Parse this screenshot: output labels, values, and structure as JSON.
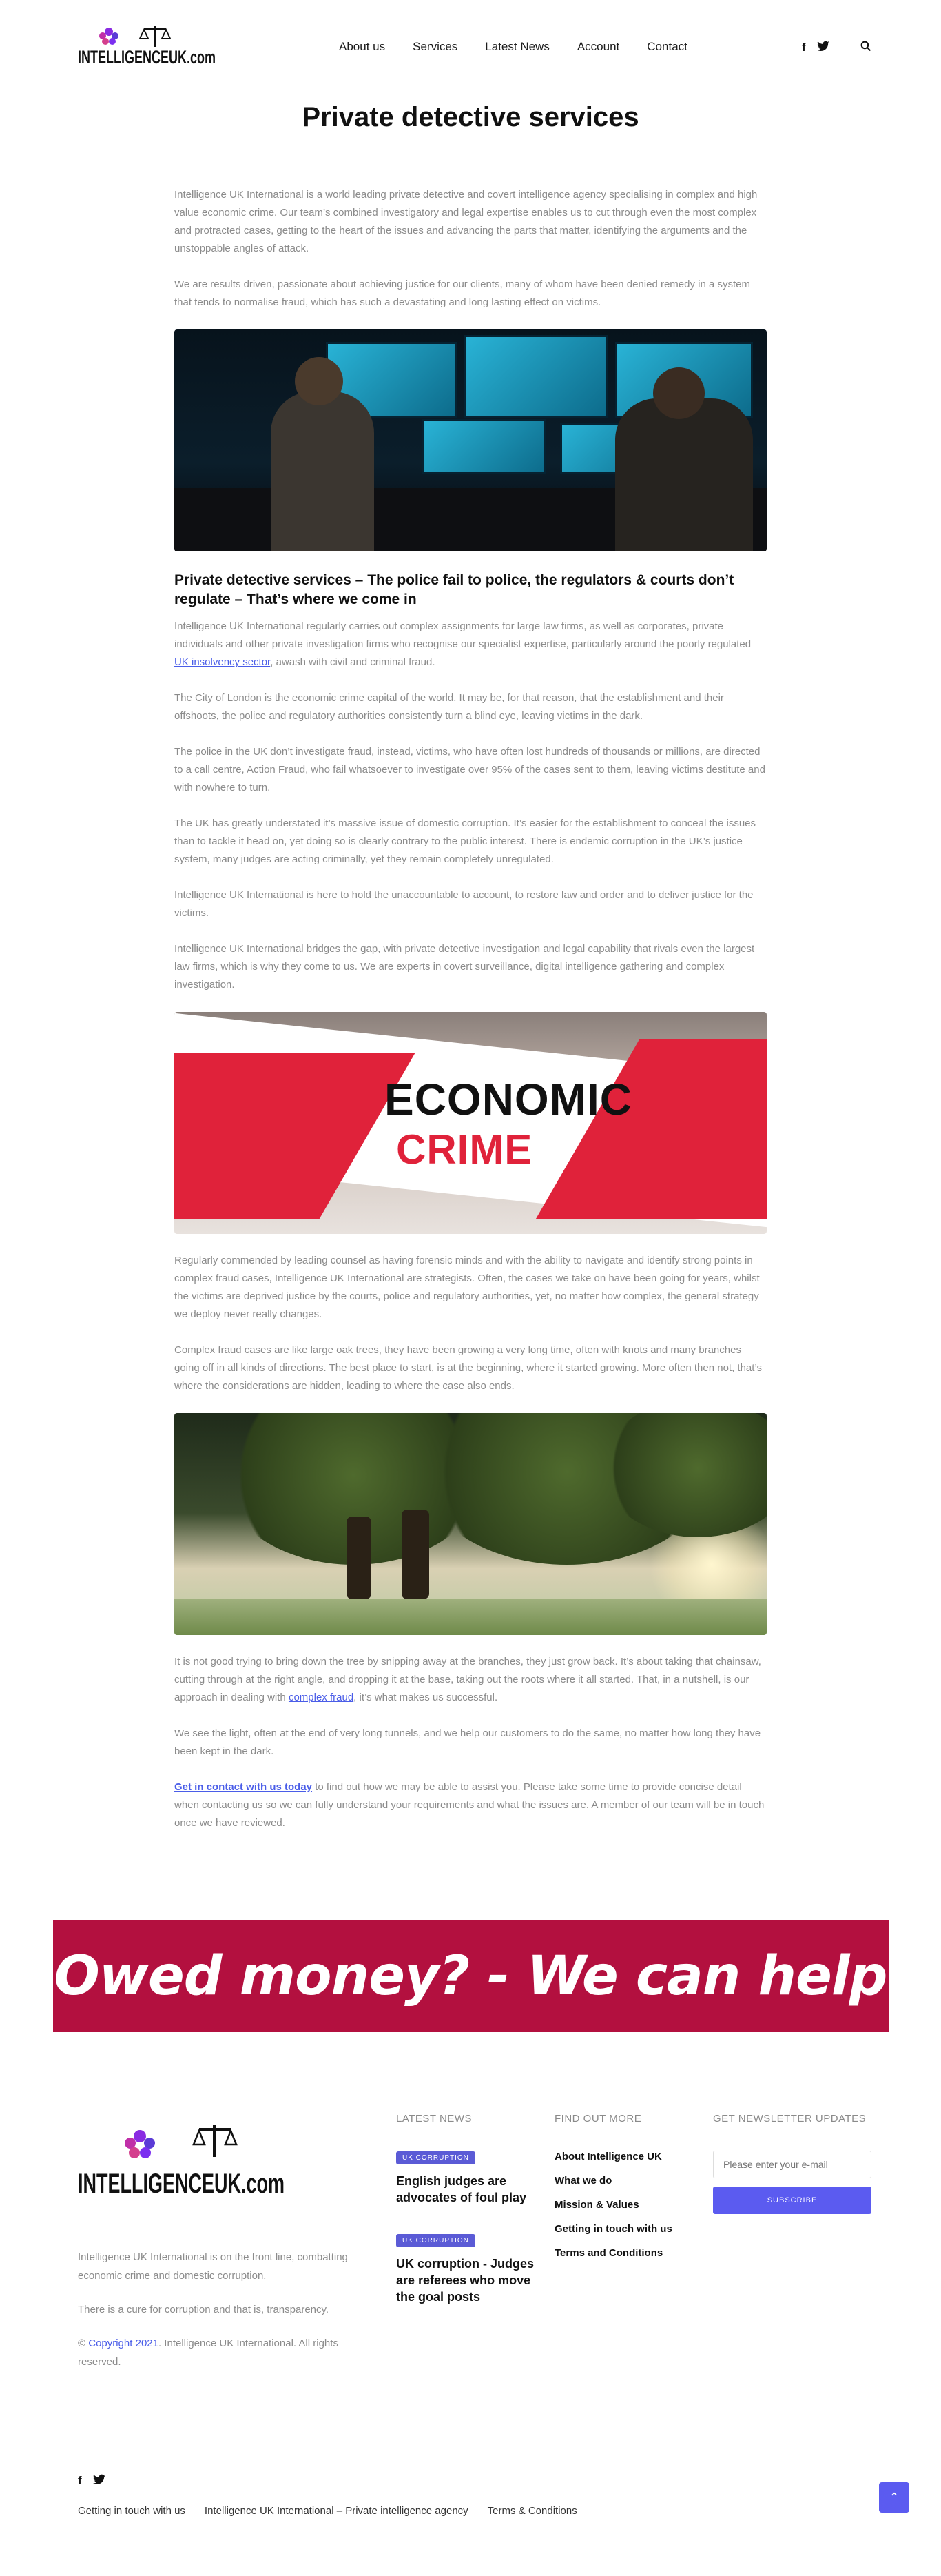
{
  "header": {
    "logo_text": "INTELLIGENCEUK.com",
    "nav": [
      "About us",
      "Services",
      "Latest News",
      "Account",
      "Contact"
    ],
    "social": [
      "facebook-icon",
      "twitter-icon"
    ],
    "search_icon": "search-icon"
  },
  "page_title": "Private detective services",
  "content": {
    "p1": "Intelligence UK International is a world leading private detective and covert intelligence agency specialising in complex and high value economic crime. Our team’s combined investigatory and legal expertise enables us to cut through even the most complex and protracted cases, getting to the heart of the issues and advancing the parts that matter, identifying the arguments and the unstoppable angles of attack.",
    "p2": "We are results driven, passionate about achieving justice for our clients, many of whom have been denied remedy in a system that tends to normalise fraud, which has such a devastating and long lasting effect on victims.",
    "h2": "Private detective services – The police fail to police, the regulators & courts don’t regulate – That’s where we come in",
    "p3_a": "Intelligence UK International regularly carries out complex assignments for large law firms, as well as corporates, private individuals and other private investigation firms who recognise our specialist expertise, particularly around the poorly regulated ",
    "p3_link": "UK insolvency sector",
    "p3_b": ", awash with civil and criminal fraud.",
    "p4": "The City of London is the economic crime capital of the world. It may be, for that reason, that the establishment and their offshoots, the police and regulatory authorities consistently turn a blind eye, leaving victims in the dark.",
    "p5": "The police in the UK don’t investigate fraud, instead, victims, who have often lost hundreds of thousands or millions, are directed to a call centre, Action Fraud, who fail whatsoever to investigate over 95% of the cases sent to them, leaving victims destitute and with nowhere to turn.",
    "p6": "The UK has greatly understated it’s massive issue of domestic corruption. It’s easier for the establishment to conceal the issues than to tackle it head on, yet doing so is clearly contrary to the public interest. There is endemic corruption in the UK’s justice system, many judges are acting criminally, yet they remain completely unregulated.",
    "p7": "Intelligence UK International is here to hold the unaccountable to account, to restore law and order and to deliver justice for the victims.",
    "p8": "Intelligence UK International bridges the gap, with private detective investigation and legal capability that rivals even the largest law firms, which is why they come to us. We are experts in covert surveillance, digital intelligence gathering and complex investigation.",
    "crime_line1": "ECONOMIC",
    "crime_line2": "CRIME",
    "p9": "Regularly commended by leading counsel as having forensic minds and with the ability to navigate and identify strong points in complex fraud cases, Intelligence UK International are strategists. Often, the cases we take on have been going for years, whilst the victims are deprived justice by the courts, police and regulatory authorities, yet, no matter how complex, the general strategy we deploy never really changes.",
    "p10": "Complex fraud cases are like large oak trees, they have been growing a very long time, often with knots and many branches going off in all kinds of directions. The best place to start, is at the beginning, where it started growing. More often then not, that’s where the considerations are hidden, leading to where the case also ends.",
    "p11_a": "It is not good trying to bring down the tree by snipping away at the branches, they just grow back. It’s about taking that chainsaw, cutting through at the right angle, and dropping it at the base, taking out the roots where it all started. That, in a nutshell, is our approach in dealing with ",
    "p11_link": "complex fraud",
    "p11_b": ", it’s what makes us successful.",
    "p12": "We see the light, often at the end of very long tunnels, and we help our customers to do the same, no matter how long they have been kept in the dark.",
    "p13_link": "Get in contact with us today",
    "p13_b": " to find out how we may be able to assist you. Please take some time to provide concise detail when contacting us so we can fully understand your requirements and what the issues are. A member of our team will be in touch once we have reviewed."
  },
  "banner": "Owed money?  - We can help",
  "footer": {
    "logo_text": "INTELLIGENCEUK.com",
    "about1": "Intelligence UK International is on the front line, combatting economic crime and domestic corruption.",
    "about2": "There is a cure for corruption and that is, transparency.",
    "copyright_link": "Copyright 2021",
    "copyright_rest": ". Intelligence UK International. All rights reserved.",
    "news_title": "LATEST NEWS",
    "news": [
      {
        "badge": "UK CORRUPTION",
        "title": "English judges are advocates of foul play"
      },
      {
        "badge": "UK CORRUPTION",
        "title": "UK corruption - Judges are referees who move the goal posts"
      }
    ],
    "more_title": "FIND OUT MORE",
    "links": [
      "About Intelligence UK",
      "What we do",
      "Mission & Values",
      "Getting in touch with us",
      "Terms and Conditions"
    ],
    "newsletter_title": "GET NEWSLETTER UPDATES",
    "email_placeholder": "Please enter your e-mail",
    "subscribe_label": "SUBSCRIBE"
  },
  "bottom": {
    "links": [
      "Getting in touch with us",
      "Intelligence UK International – Private intelligence agency",
      "Terms & Conditions"
    ]
  },
  "colors": {
    "accent": "#5b5bf0",
    "banner": "#b3103f",
    "link": "#4a5de8"
  }
}
